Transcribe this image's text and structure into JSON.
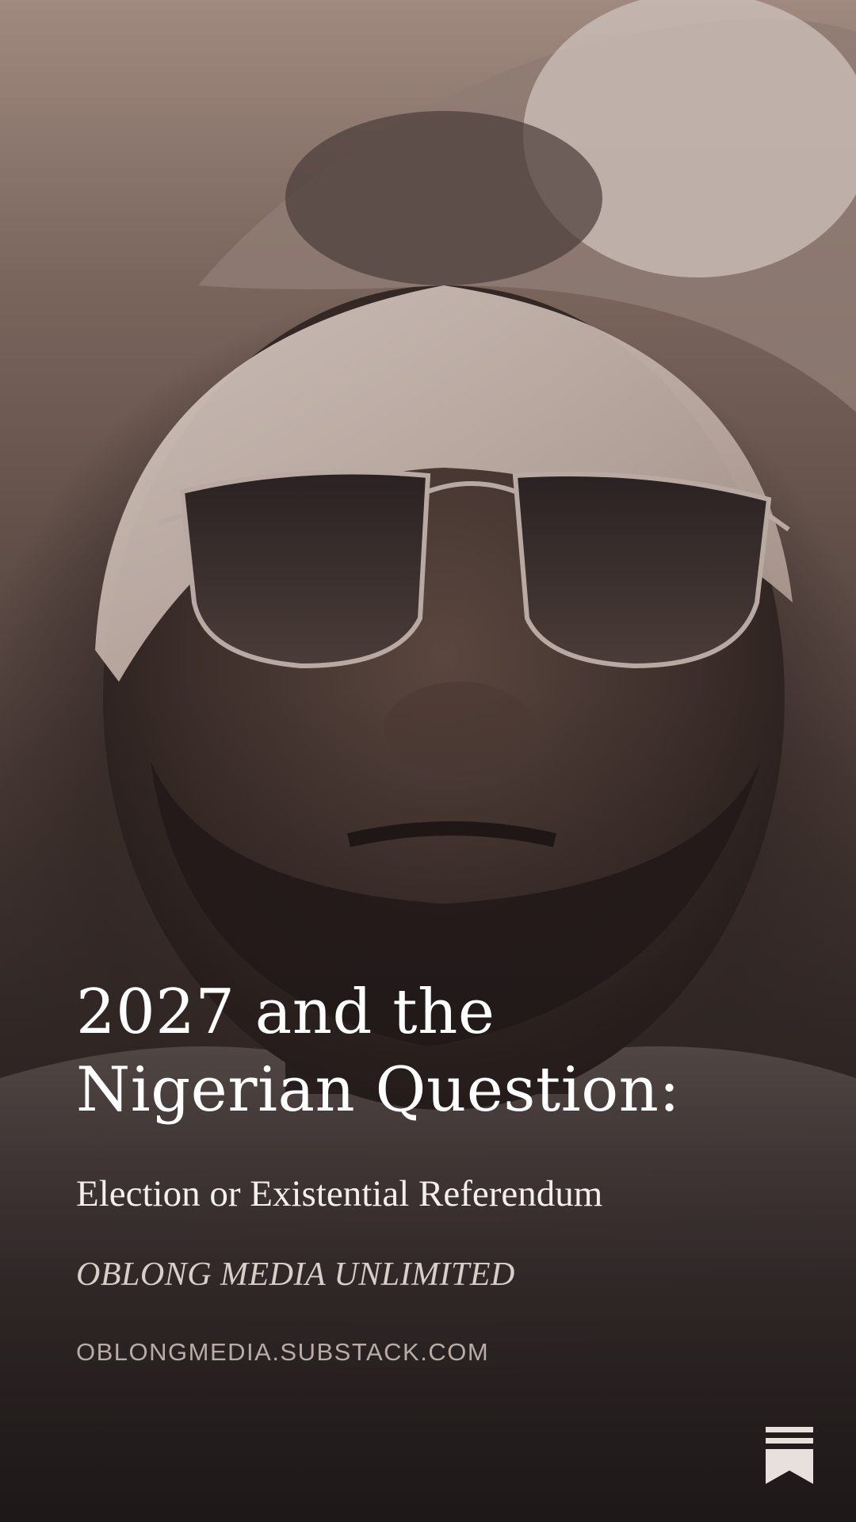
{
  "post": {
    "title": "2027 and the Nigerian Question:",
    "subtitle": "Election or Existential Referendum",
    "publication": "OBLONG MEDIA UNLIMITED",
    "url": "OBLONGMEDIA.SUBSTACK.COM"
  },
  "icons": {
    "brand_logo": "substack-bookmark-icon"
  },
  "colors": {
    "text_primary": "#ffffff",
    "text_secondary": "#d9cfca",
    "text_muted": "#b9aca7",
    "logo": "#e8e0dc"
  }
}
